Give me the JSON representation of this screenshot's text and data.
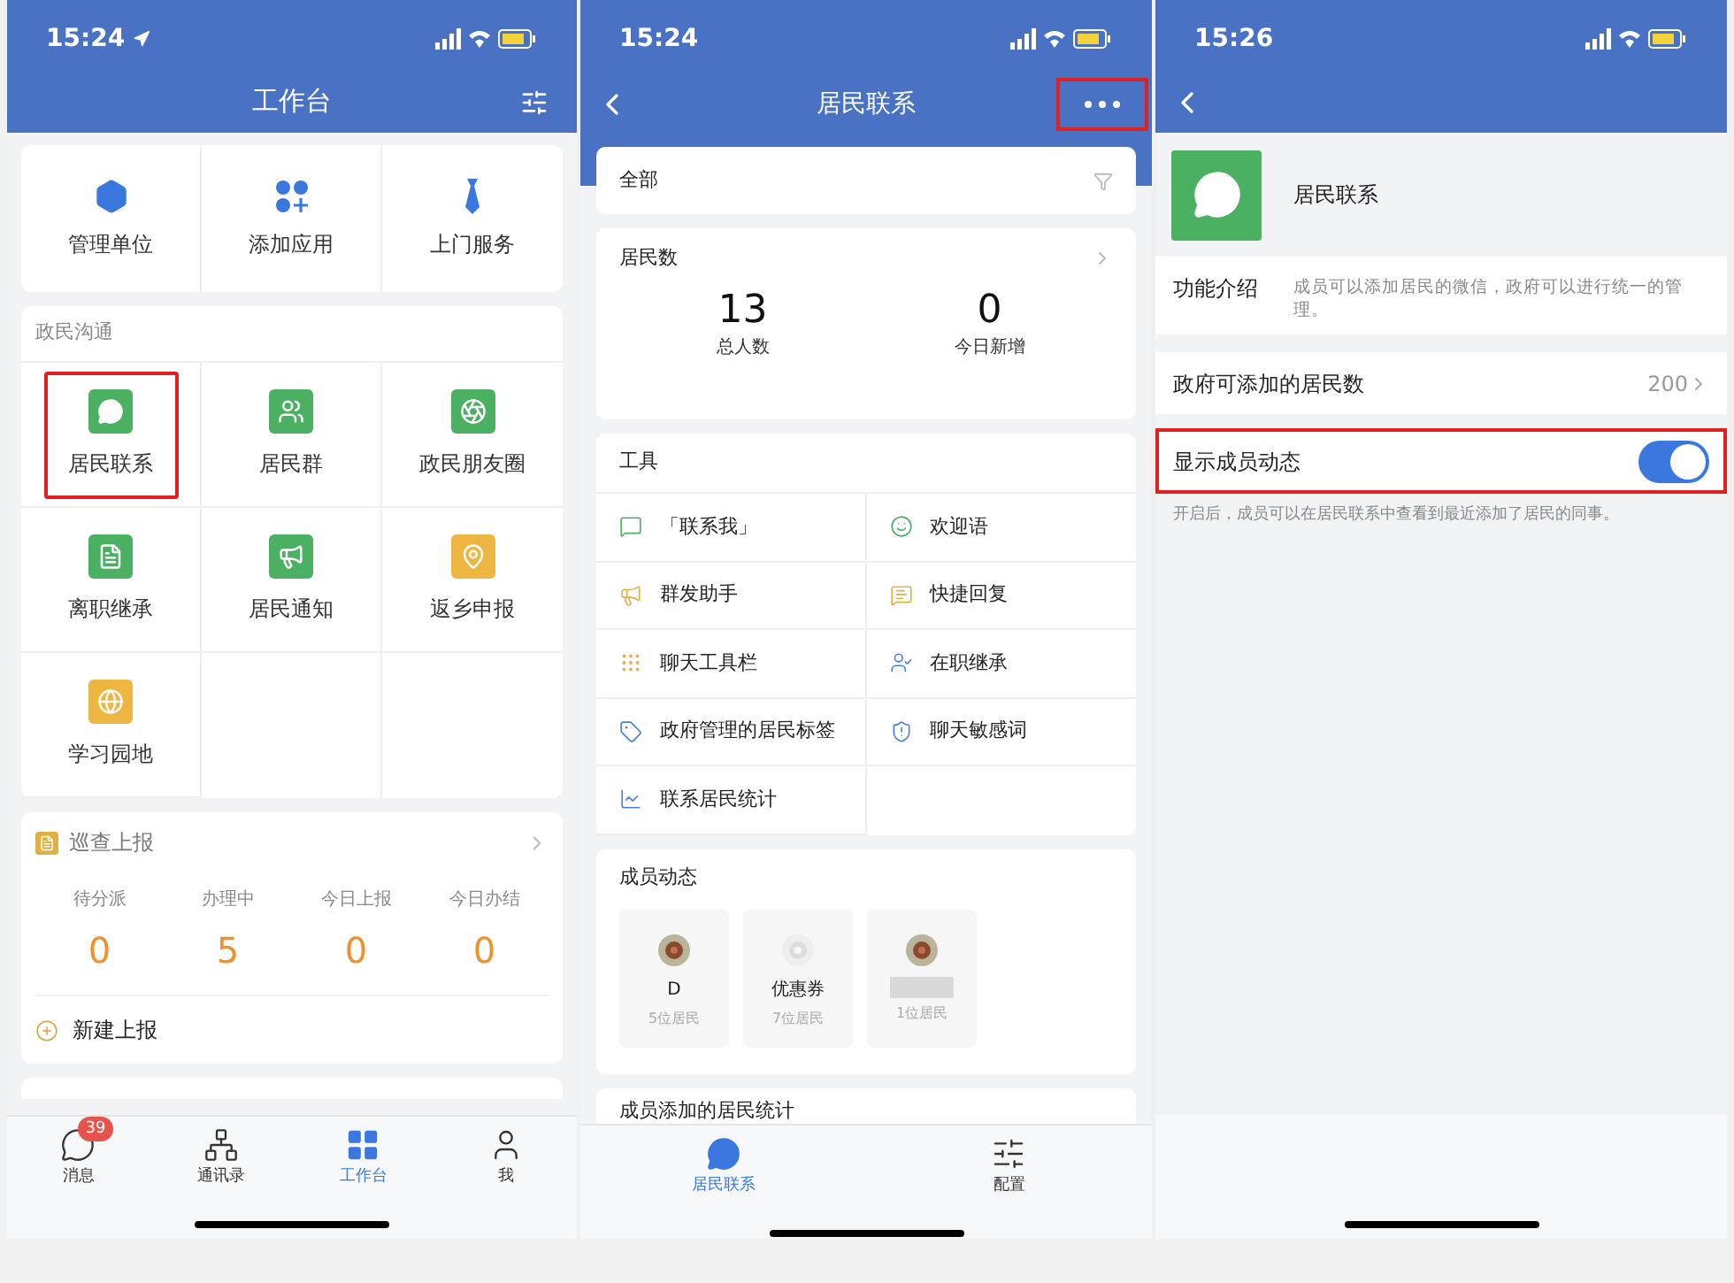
{
  "workbench": {
    "status_time": "15:24",
    "title": "工作台",
    "top_apps": [
      {
        "label": "管理单位",
        "highlighted": false
      },
      {
        "label": "添加应用",
        "highlighted": false
      },
      {
        "label": "上门服务",
        "highlighted": false
      }
    ],
    "section": {
      "title": "政民沟通",
      "apps": [
        {
          "label": "居民联系",
          "color": "#4cb062",
          "highlighted": true
        },
        {
          "label": "居民群",
          "color": "#4cb062",
          "highlighted": false
        },
        {
          "label": "政民朋友圈",
          "color": "#4cb062",
          "highlighted": false
        },
        {
          "label": "离职继承",
          "color": "#4cb062",
          "highlighted": false
        },
        {
          "label": "居民通知",
          "color": "#4cb062",
          "highlighted": false
        },
        {
          "label": "返乡申报",
          "color": "#edb640",
          "highlighted": false
        },
        {
          "label": "学习园地",
          "color": "#edb640",
          "highlighted": false
        }
      ]
    },
    "report": {
      "title": "巡查上报",
      "stats": [
        {
          "label": "待分派",
          "value": "0"
        },
        {
          "label": "办理中",
          "value": "5"
        },
        {
          "label": "今日上报",
          "value": "0"
        },
        {
          "label": "今日办结",
          "value": "0"
        }
      ],
      "new_button": "新建上报"
    },
    "tabbar": [
      {
        "label": "消息",
        "selected": false,
        "badge": "39"
      },
      {
        "label": "通讯录",
        "selected": false
      },
      {
        "label": "工作台",
        "selected": true
      },
      {
        "label": "我",
        "selected": false
      }
    ]
  },
  "resident_contact": {
    "status_time": "15:24",
    "title": "居民联系",
    "more_highlighted": true,
    "filter": "全部",
    "counts": {
      "title": "居民数",
      "stats": [
        {
          "value": "13",
          "label": "总人数"
        },
        {
          "value": "0",
          "label": "今日新增"
        }
      ]
    },
    "tools": {
      "title": "工具",
      "items": [
        {
          "label": "「联系我」",
          "color": "#4cb062"
        },
        {
          "label": "欢迎语",
          "color": "#4cb062"
        },
        {
          "label": "群发助手",
          "color": "#e0b040"
        },
        {
          "label": "快捷回复",
          "color": "#e0b040"
        },
        {
          "label": "聊天工具栏",
          "color": "#e0b040"
        },
        {
          "label": "在职继承",
          "color": "#4a7fe0"
        },
        {
          "label": "政府管理的居民标签",
          "color": "#4a7fe0"
        },
        {
          "label": "聊天敏感词",
          "color": "#4a7fe0"
        },
        {
          "label": "联系居民统计",
          "color": "#4a7fe0"
        }
      ]
    },
    "members": {
      "title": "成员动态",
      "items": [
        {
          "name": "D",
          "count": "5位居民"
        },
        {
          "name": "优惠券",
          "count": "7位居民"
        },
        {
          "count": "1位居民"
        }
      ]
    },
    "stats_card": "成员添加的居民统计",
    "tabbar": [
      {
        "label": "居民联系",
        "selected": true
      },
      {
        "label": "配置",
        "selected": false
      }
    ]
  },
  "settings": {
    "status_time": "15:26",
    "app_name": "居民联系",
    "intro_label": "功能介绍",
    "intro_text": "成员可以添加居民的微信，政府可以进行统一的管理。",
    "limit_label": "政府可添加的居民数",
    "limit_value": "200",
    "toggle": {
      "label": "显示成员动态",
      "on": true,
      "highlighted": true
    },
    "hint": "开启后，成员可以在居民联系中查看到最近添加了居民的同事。"
  }
}
